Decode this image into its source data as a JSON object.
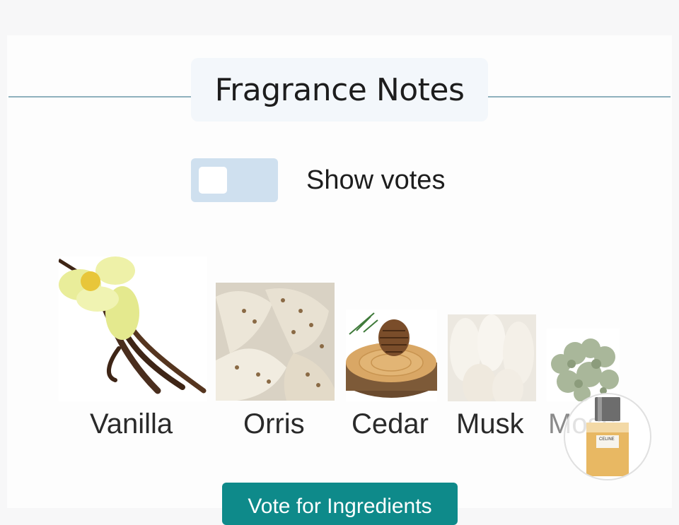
{
  "section": {
    "title": "Fragrance Notes"
  },
  "toggle": {
    "label": "Show votes",
    "checked": false
  },
  "notes": [
    {
      "name": "Vanilla",
      "icon": "vanilla-image"
    },
    {
      "name": "Orris",
      "icon": "orris-image"
    },
    {
      "name": "Cedar",
      "icon": "cedar-image"
    },
    {
      "name": "Musk",
      "icon": "musk-image"
    },
    {
      "name": "Moss",
      "icon": "moss-image"
    }
  ],
  "perfume_badge": {
    "bottle_label": "CELINE",
    "icon": "perfume-bottle-image"
  },
  "vote_button": {
    "label": "Vote for Ingredients"
  },
  "colors": {
    "accent": "#0e8a8a",
    "divider": "#8fb1bd",
    "toggle_track": "#cfe0ef",
    "title_bg": "#f3f7fb"
  }
}
